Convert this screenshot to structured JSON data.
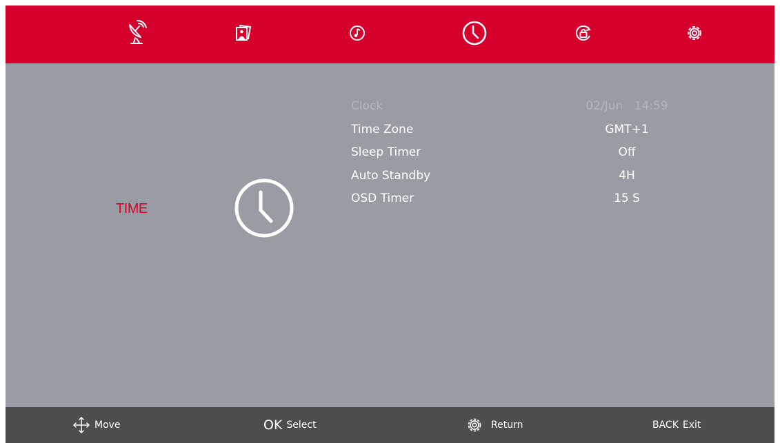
{
  "top_nav": {
    "items": [
      {
        "id": "channel",
        "icon": "satellite-dish-icon"
      },
      {
        "id": "picture",
        "icon": "picture-icon"
      },
      {
        "id": "sound",
        "icon": "sound-icon"
      },
      {
        "id": "time",
        "icon": "clock-icon",
        "selected": true
      },
      {
        "id": "lock",
        "icon": "lock-icon"
      },
      {
        "id": "setup",
        "icon": "gear-icon"
      }
    ],
    "bar_color": "#d6002d"
  },
  "section": {
    "title": "TIME",
    "icon": "clock-icon",
    "title_color": "#d6002d"
  },
  "settings": {
    "clock": {
      "label": "Clock",
      "date": "02/Jun",
      "time": "14:59",
      "enabled": false
    },
    "time_zone": {
      "label": "Time Zone",
      "value": "GMT+1"
    },
    "sleep_timer": {
      "label": "Sleep Timer",
      "value": "Off"
    },
    "auto_standby": {
      "label": "Auto Standby",
      "value": "4H"
    },
    "osd_timer": {
      "label": "OSD Timer",
      "value": "15 S"
    }
  },
  "footer": {
    "move": {
      "icon": "move-arrows-icon",
      "label": "Move"
    },
    "select": {
      "key": "OK",
      "label": "Select"
    },
    "return": {
      "icon": "gear-icon",
      "label": "Return"
    },
    "exit": {
      "key": "BACK",
      "label": "Exit"
    }
  }
}
